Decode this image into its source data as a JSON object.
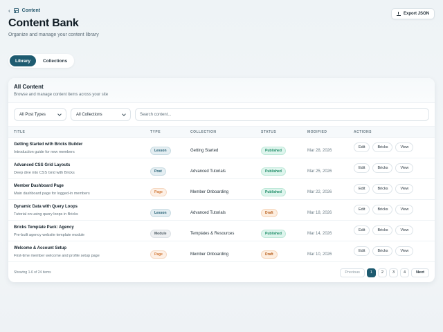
{
  "breadcrumb": {
    "back_icon": "chevron-left-icon",
    "section_icon": "grid-icon",
    "label": "Content"
  },
  "header": {
    "title": "Content Bank",
    "subtitle": "Organize and manage your content library",
    "export_label": "Export JSON",
    "export_icon": "download-icon"
  },
  "tabs": [
    {
      "label": "Library",
      "active": true
    },
    {
      "label": "Collections",
      "active": false
    }
  ],
  "card": {
    "title": "All Content",
    "subtitle": "Browse and manage content items across your site",
    "filters": {
      "post_types": "All Post Types",
      "collections": "All Collections",
      "search_placeholder": "Search content..."
    },
    "columns": [
      "TITLE",
      "TYPE",
      "COLLECTION",
      "STATUS",
      "MODIFIED",
      "ACTIONS"
    ],
    "rows": [
      {
        "title": "Getting Started with Bricks Builder",
        "desc": "Introduction guide for new members",
        "type": "Lesson",
        "collection": "Getting Started",
        "status": "Published",
        "modified": "Mar 28, 2026"
      },
      {
        "title": "Advanced CSS Grid Layouts",
        "desc": "Deep dive into CSS Grid with Bricks",
        "type": "Post",
        "collection": "Advanced Tutorials",
        "status": "Published",
        "modified": "Mar 25, 2026"
      },
      {
        "title": "Member Dashboard Page",
        "desc": "Main dashboard page for logged-in members",
        "type": "Page",
        "collection": "Member Onboarding",
        "status": "Published",
        "modified": "Mar 22, 2026"
      },
      {
        "title": "Dynamic Data with Query Loops",
        "desc": "Tutorial on using query loops in Bricks",
        "type": "Lesson",
        "collection": "Advanced Tutorials",
        "status": "Draft",
        "modified": "Mar 18, 2026"
      },
      {
        "title": "Bricks Template Pack: Agency",
        "desc": "Pre-built agency website template module",
        "type": "Module",
        "collection": "Templates & Resources",
        "status": "Published",
        "modified": "Mar 14, 2026"
      },
      {
        "title": "Welcome & Account Setup",
        "desc": "First-time member welcome and profile setup page",
        "type": "Page",
        "collection": "Member Onboarding",
        "status": "Draft",
        "modified": "Mar 10, 2026"
      }
    ],
    "actions": {
      "edit": "Edit",
      "bricks": "Bricks",
      "view": "View"
    },
    "footer": {
      "info": "Showing 1-6 of 24 items",
      "prev": "Previous",
      "pages": [
        "1",
        "2",
        "3",
        "4"
      ],
      "next": "Next",
      "current_page": "1"
    }
  },
  "colors": {
    "accent": "#1e5b70",
    "published": "#1a8a64",
    "draft": "#b85f1d",
    "page_badge": "#d17a39"
  }
}
